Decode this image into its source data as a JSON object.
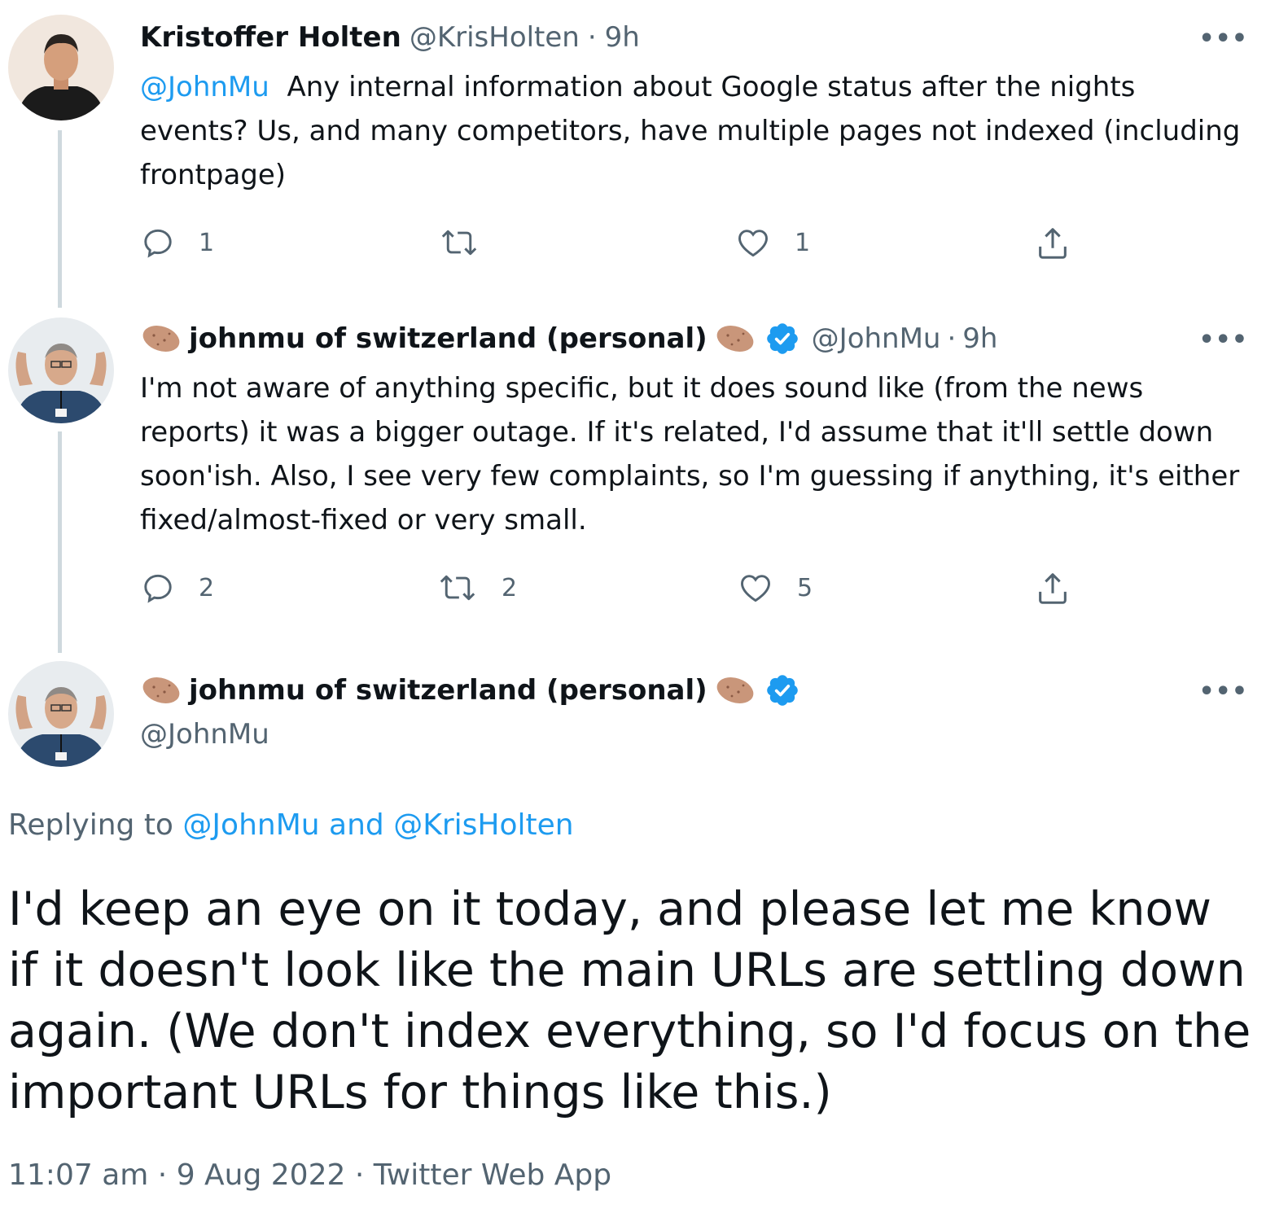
{
  "tweets": [
    {
      "author_name": "Kristoffer Holten",
      "handle": "@KrisHolten",
      "separator": "·",
      "time": "9h",
      "more": "•••",
      "mention": "@JohnMu",
      "text": "Any internal information about Google status after the nights events? Us, and many competitors, have multiple pages not indexed (including frontpage)",
      "replies": "1",
      "retweets": "",
      "likes": "1"
    },
    {
      "author_name": "johnmu of switzerland (personal)",
      "handle": "@JohnMu",
      "separator": "·",
      "time": "9h",
      "more": "•••",
      "text": "I'm not aware of anything specific, but it does sound like (from the news reports) it was a bigger outage. If it's related, I'd assume that it'll settle down soon'ish. Also, I see very few complaints, so I'm guessing if anything, it's either fixed/almost-fixed or very small.",
      "replies": "2",
      "retweets": "2",
      "likes": "5"
    }
  ],
  "main_tweet": {
    "author_name": "johnmu of switzerland (personal)",
    "handle": "@JohnMu",
    "more": "•••",
    "replying_prefix": "Replying to",
    "replying_user1": "@JohnMu",
    "replying_and": "and",
    "replying_user2": "@KrisHolten",
    "text": "I'd keep an eye on it today, and please let me know if it doesn't look like the main URLs are settling down again. (We don't index everything, so I'd focus on the important URLs for things like this.)",
    "time": "11:07 am",
    "separator": "·",
    "date": "9 Aug 2022",
    "source": "Twitter Web App"
  },
  "icons": {
    "reply": "reply-icon",
    "retweet": "retweet-icon",
    "like": "heart-icon",
    "share": "share-icon",
    "verified": "verified-badge-icon",
    "emoji": "potato-emoji-icon"
  },
  "colors": {
    "link": "#1d9bf0",
    "muted": "#536471",
    "text": "#0f1419",
    "verified": "#1d9bf0",
    "thread_line": "#cfd9de"
  }
}
